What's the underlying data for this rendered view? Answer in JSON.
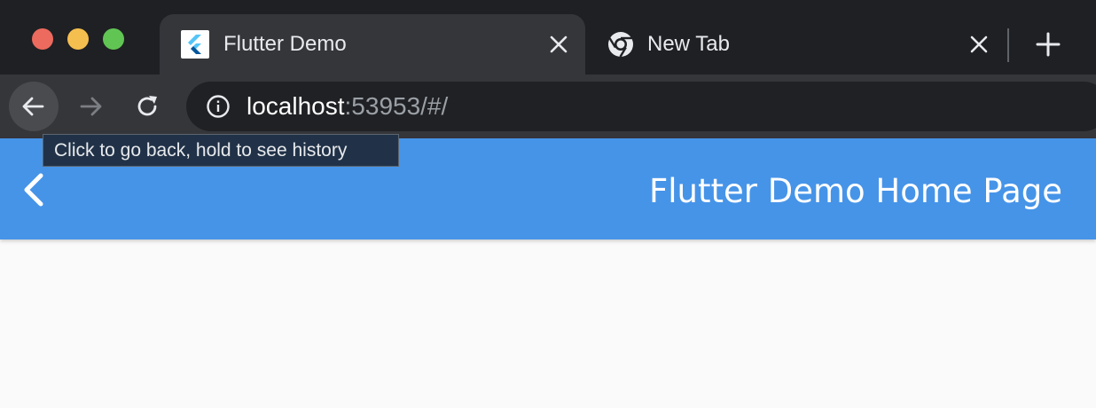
{
  "tabs": [
    {
      "title": "Flutter Demo",
      "favicon": "flutter-logo",
      "active": true
    },
    {
      "title": "New Tab",
      "favicon": "chrome-logo",
      "active": false
    }
  ],
  "toolbar": {
    "url_host": "localhost",
    "url_rest": ":53953/#/"
  },
  "tooltip": {
    "text": "Click to go back, hold to see history"
  },
  "app": {
    "appbar_title": "Flutter Demo Home Page",
    "appbar_color": "#4694e8"
  },
  "icons": {
    "back": "arrow-left-icon",
    "forward": "arrow-right-icon",
    "reload": "reload-icon",
    "info": "info-icon",
    "close": "close-icon",
    "new_tab": "plus-icon",
    "app_back": "chevron-left-icon"
  }
}
